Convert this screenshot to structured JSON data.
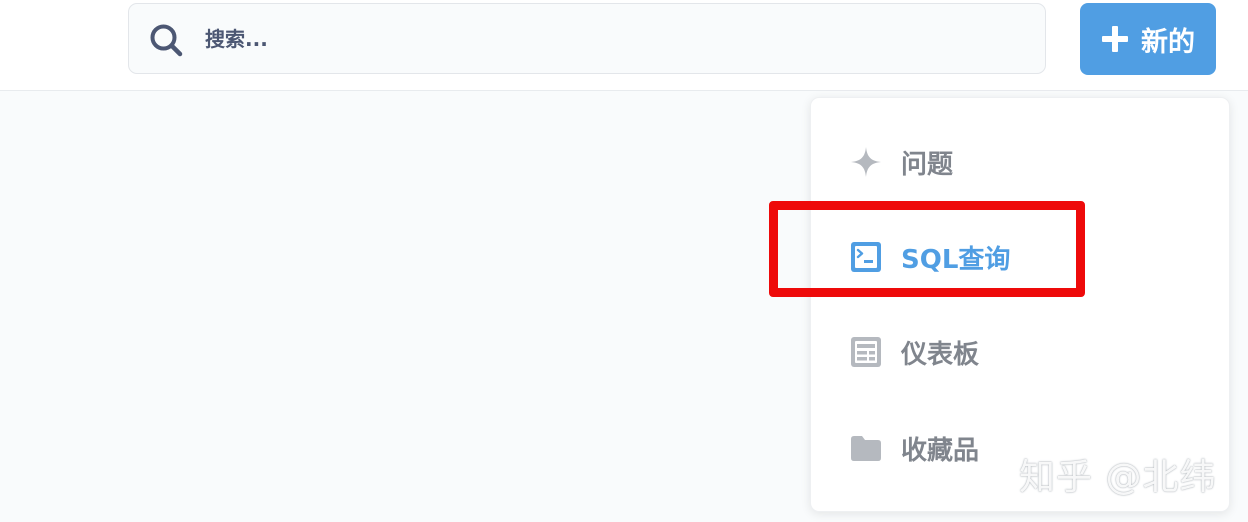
{
  "header": {
    "search_placeholder": "搜索...",
    "new_button_label": "新的"
  },
  "new_menu": {
    "items": [
      {
        "label": "问题",
        "icon": "sparkle-icon"
      },
      {
        "label": "SQL查询",
        "icon": "terminal-icon",
        "active": true
      },
      {
        "label": "仪表板",
        "icon": "dashboard-icon"
      },
      {
        "label": "收藏品",
        "icon": "folder-icon"
      }
    ]
  },
  "watermark": {
    "text": "知乎 @北纬"
  },
  "colors": {
    "brand_blue": "#509ee3",
    "highlight_red": "#ee0a0a",
    "menu_text_gray": "#80858d",
    "icon_gray": "#b5b9bf"
  }
}
